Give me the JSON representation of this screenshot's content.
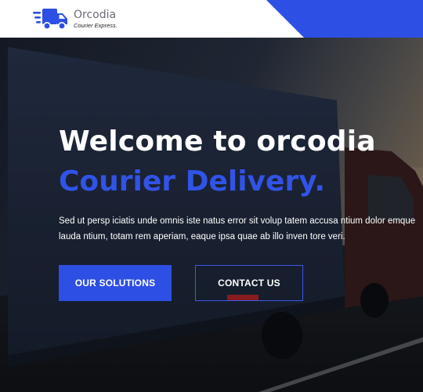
{
  "header": {
    "brand": "Orcodia",
    "tagline": "Courier Express.",
    "accent_color": "#2d4fe3",
    "logo_icon": "delivery-truck-icon"
  },
  "hero": {
    "title": "Welcome to orcodia",
    "subtitle": "Courier Delivery.",
    "subtitle_color": "#3153e6",
    "text": "Sed ut persp iciatis unde omnis iste natus error sit volup tatem accusa ntium dolor emque lauda ntium, totam rem aperiam, eaque ipsa quae ab illo inven tore veri.",
    "buttons": {
      "solutions_label": "OUR SOLUTIONS",
      "contact_label": "CONTACT US"
    }
  }
}
